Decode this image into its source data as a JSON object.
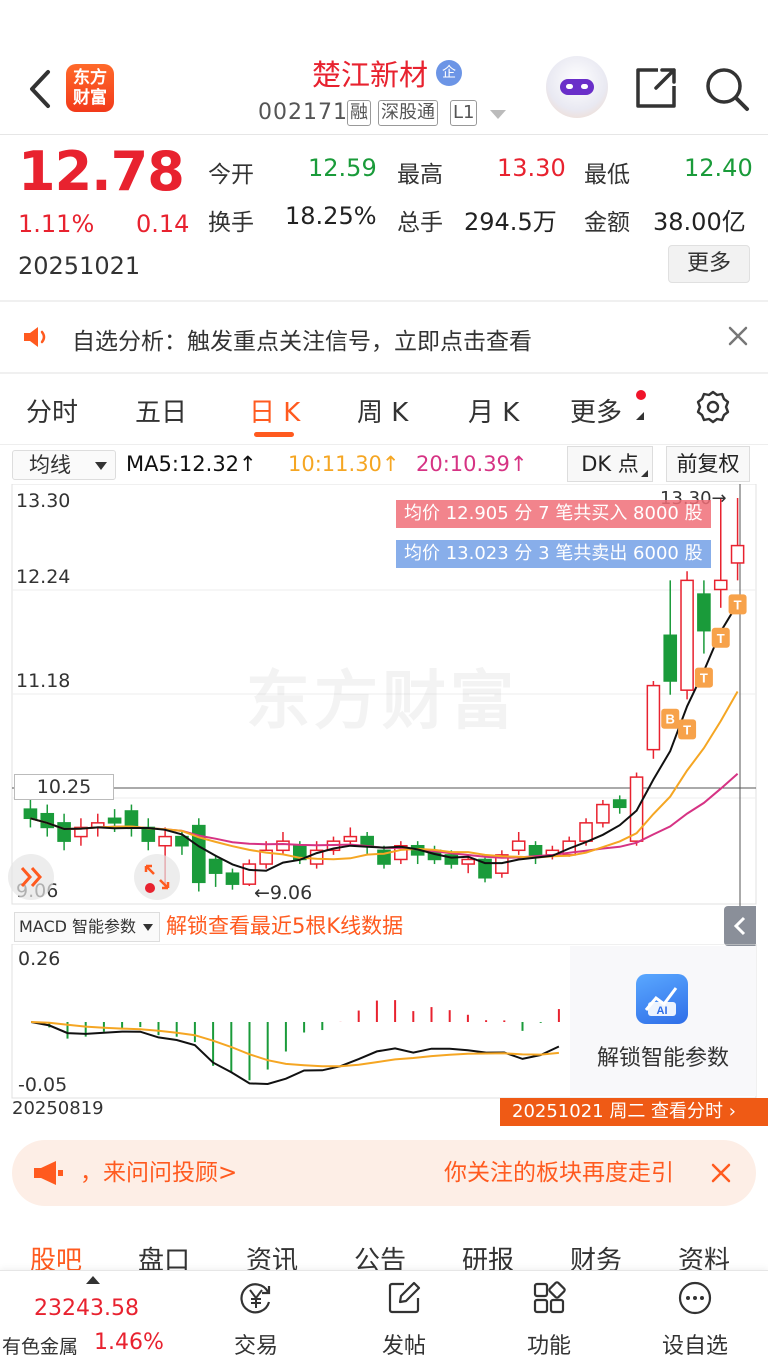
{
  "header": {
    "stock_name": "楚江新材",
    "badge": "企",
    "stock_code": "002171",
    "tags": [
      "融",
      "深股通",
      "L1"
    ],
    "logo_text_line1": "东方",
    "logo_text_line2": "财富"
  },
  "quote": {
    "price": "12.78",
    "change_pct": "1.11%",
    "change_abs": "0.14",
    "date": "20251021",
    "fields": [
      {
        "label": "今开",
        "value": "12.59",
        "color": "green"
      },
      {
        "label": "最高",
        "value": "13.30",
        "color": "red"
      },
      {
        "label": "最低",
        "value": "12.40",
        "color": "green"
      },
      {
        "label": "换手",
        "value": "18.25%",
        "color": "dark"
      },
      {
        "label": "总手",
        "value": "294.5万",
        "color": "dark"
      },
      {
        "label": "金额",
        "value": "38.00亿",
        "color": "dark"
      }
    ],
    "more_label": "更多"
  },
  "notice": {
    "text": "自选分析：触发重点关注信号，立即点击查看"
  },
  "tabs": [
    "分时",
    "五日",
    "日 K",
    "周 K",
    "月 K",
    "更多"
  ],
  "active_tab": "日 K",
  "chart_toolbar": {
    "ma_select": "均线",
    "ma5": "MA5:12.32↑",
    "ma10": "10:11.30↑",
    "ma20": "20:10.39↑",
    "dk_label": "DK 点",
    "fq_label": "前复权"
  },
  "colors": {
    "up": "#e8222f",
    "down": "#1a9b3a",
    "accent": "#ff5a1f",
    "ma5": "#111111",
    "ma10": "#f5a623",
    "ma20": "#d63384"
  },
  "chart_data": {
    "type": "candlestick",
    "y_ticks": [
      "13.30",
      "12.24",
      "11.18",
      "10.25",
      "9.06"
    ],
    "ylim": [
      9.06,
      13.3
    ],
    "min_label": "9.06",
    "max_label": "13.30",
    "trade_buy": "均价 12.905 分 7 笔共买入 8000 股",
    "trade_sell": "均价 13.023 分 3 笔共卖出 6000 股",
    "watermark": "东方财富",
    "candles": [
      {
        "o": 9.9,
        "c": 9.8,
        "h": 10.0,
        "l": 9.7
      },
      {
        "o": 9.85,
        "c": 9.7,
        "h": 9.95,
        "l": 9.6
      },
      {
        "o": 9.75,
        "c": 9.55,
        "h": 9.85,
        "l": 9.45
      },
      {
        "o": 9.6,
        "c": 9.7,
        "h": 9.8,
        "l": 9.5
      },
      {
        "o": 9.7,
        "c": 9.75,
        "h": 9.85,
        "l": 9.6
      },
      {
        "o": 9.8,
        "c": 9.75,
        "h": 9.9,
        "l": 9.65
      },
      {
        "o": 9.88,
        "c": 9.72,
        "h": 9.95,
        "l": 9.6
      },
      {
        "o": 9.7,
        "c": 9.55,
        "h": 9.8,
        "l": 9.45
      },
      {
        "o": 9.5,
        "c": 9.6,
        "h": 9.7,
        "l": 9.05
      },
      {
        "o": 9.6,
        "c": 9.5,
        "h": 9.65,
        "l": 9.4
      },
      {
        "o": 9.72,
        "c": 9.1,
        "h": 9.8,
        "l": 9.0
      },
      {
        "o": 9.35,
        "c": 9.2,
        "h": 9.4,
        "l": 9.05
      },
      {
        "o": 9.2,
        "c": 9.08,
        "h": 9.25,
        "l": 9.02
      },
      {
        "o": 9.08,
        "c": 9.3,
        "h": 9.35,
        "l": 9.06
      },
      {
        "o": 9.3,
        "c": 9.45,
        "h": 9.55,
        "l": 9.25
      },
      {
        "o": 9.45,
        "c": 9.55,
        "h": 9.65,
        "l": 9.4
      },
      {
        "o": 9.5,
        "c": 9.35,
        "h": 9.55,
        "l": 9.3
      },
      {
        "o": 9.3,
        "c": 9.45,
        "h": 9.55,
        "l": 9.25
      },
      {
        "o": 9.45,
        "c": 9.55,
        "h": 9.6,
        "l": 9.4
      },
      {
        "o": 9.55,
        "c": 9.6,
        "h": 9.7,
        "l": 9.5
      },
      {
        "o": 9.6,
        "c": 9.5,
        "h": 9.65,
        "l": 9.4
      },
      {
        "o": 9.45,
        "c": 9.3,
        "h": 9.5,
        "l": 9.25
      },
      {
        "o": 9.35,
        "c": 9.5,
        "h": 9.55,
        "l": 9.3
      },
      {
        "o": 9.5,
        "c": 9.4,
        "h": 9.55,
        "l": 9.3
      },
      {
        "o": 9.45,
        "c": 9.35,
        "h": 9.5,
        "l": 9.3
      },
      {
        "o": 9.4,
        "c": 9.3,
        "h": 9.45,
        "l": 9.25
      },
      {
        "o": 9.3,
        "c": 9.35,
        "h": 9.4,
        "l": 9.2
      },
      {
        "o": 9.35,
        "c": 9.15,
        "h": 9.4,
        "l": 9.1
      },
      {
        "o": 9.2,
        "c": 9.4,
        "h": 9.45,
        "l": 9.15
      },
      {
        "o": 9.45,
        "c": 9.55,
        "h": 9.65,
        "l": 9.4
      },
      {
        "o": 9.5,
        "c": 9.4,
        "h": 9.55,
        "l": 9.3
      },
      {
        "o": 9.4,
        "c": 9.45,
        "h": 9.5,
        "l": 9.35
      },
      {
        "o": 9.4,
        "c": 9.55,
        "h": 9.6,
        "l": 9.38
      },
      {
        "o": 9.55,
        "c": 9.75,
        "h": 9.8,
        "l": 9.5
      },
      {
        "o": 9.75,
        "c": 9.95,
        "h": 10.0,
        "l": 9.7
      },
      {
        "o": 10.0,
        "c": 9.92,
        "h": 10.05,
        "l": 9.85
      },
      {
        "o": 9.55,
        "c": 10.25,
        "h": 10.3,
        "l": 9.5
      },
      {
        "o": 10.55,
        "c": 11.25,
        "h": 11.3,
        "l": 10.45
      },
      {
        "o": 11.8,
        "c": 11.3,
        "h": 12.4,
        "l": 11.15
      },
      {
        "o": 11.2,
        "c": 12.4,
        "h": 12.5,
        "l": 11.1
      },
      {
        "o": 12.25,
        "c": 11.85,
        "h": 12.4,
        "l": 11.6
      },
      {
        "o": 12.3,
        "c": 12.4,
        "h": 13.3,
        "l": 12.1
      },
      {
        "o": 12.59,
        "c": 12.78,
        "h": 13.3,
        "l": 12.4
      }
    ]
  },
  "macd": {
    "select_label": "MACD 智能参数",
    "unlock_text": "解锁查看最近5根K线数据",
    "y_top": "0.26",
    "y_bottom": "-0.05",
    "ai_unlock": "解锁智能参数",
    "ai_badge": "AI",
    "start_date": "20250819",
    "end_bar": "20251021 周二 查看分时 ›"
  },
  "ad": {
    "left_text": "，来问问投顾>",
    "right_text": "你关注的板块再度走引"
  },
  "bottom_tabs": [
    "股吧",
    "盘口",
    "资讯",
    "公告",
    "研报",
    "财务",
    "资料"
  ],
  "bottom_nav": {
    "index_value": "23243.58",
    "index_name": "有色金属",
    "index_pct": "1.46%",
    "items": [
      {
        "label": "交易",
        "icon": "yen-icon"
      },
      {
        "label": "发帖",
        "icon": "edit-icon"
      },
      {
        "label": "功能",
        "icon": "grid-icon"
      },
      {
        "label": "设自选",
        "icon": "more-icon"
      }
    ]
  }
}
